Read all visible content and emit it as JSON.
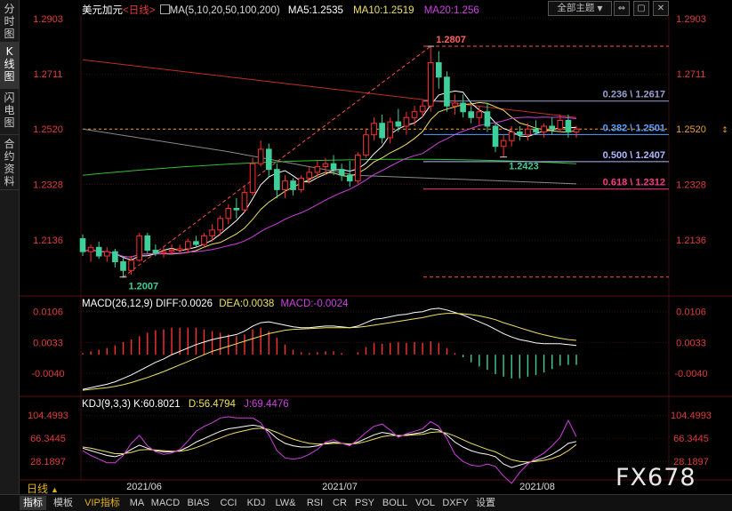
{
  "header": {
    "symbol": "美元加元",
    "period": "<日线>",
    "ma_label": "MA(5,10,20,50,100,200)",
    "ma5": "MA5:1.2535",
    "ma10": "MA10:1.2519",
    "ma20": "MA20:1.256",
    "theme_button": "全部主题",
    "theme_arrow": "▼"
  },
  "window_buttons": [
    "⇔",
    "▢",
    "✕"
  ],
  "left_nav": [
    {
      "label": "分时图",
      "active": false
    },
    {
      "label": "K线图",
      "active": true
    },
    {
      "label": "闪电图",
      "active": false
    },
    {
      "label": "合约资料",
      "active": false
    }
  ],
  "colors": {
    "up": "#3fcf9a",
    "down": "#ff3030",
    "ma5": "#ffffff",
    "ma10": "#f0e060",
    "ma20": "#d040e0",
    "ma50": "#30c030",
    "ma100": "#8a8a8a",
    "ma200": "#c03020",
    "axis_text": "#e03c3c",
    "grid": "#3a0f0f"
  },
  "chart_data": [
    {
      "type": "candlestick",
      "title": "美元加元 日线",
      "y_ticks": [
        "1.2903",
        "1.2711",
        "1.2520",
        "1.2328",
        "1.2136"
      ],
      "ylim": [
        1.196,
        1.2915
      ],
      "current_price": "1.2520",
      "x_labels": [
        "2021/06",
        "2021/07",
        "2021/08"
      ],
      "ohlc": [
        [
          1.214,
          1.2155,
          1.208,
          1.2095
        ],
        [
          1.2095,
          1.212,
          1.206,
          1.211
        ],
        [
          1.211,
          1.213,
          1.207,
          1.208
        ],
        [
          1.208,
          1.211,
          1.206,
          1.2095
        ],
        [
          1.2095,
          1.2105,
          1.204,
          1.206
        ],
        [
          1.206,
          1.208,
          1.2005,
          1.203
        ],
        [
          1.203,
          1.208,
          1.2015,
          1.2065
        ],
        [
          1.2065,
          1.216,
          1.206,
          1.215
        ],
        [
          1.215,
          1.216,
          1.209,
          1.21
        ],
        [
          1.21,
          1.212,
          1.208,
          1.209
        ],
        [
          1.209,
          1.211,
          1.2075,
          1.2095
        ],
        [
          1.2095,
          1.212,
          1.2085,
          1.21
        ],
        [
          1.21,
          1.212,
          1.209,
          1.2105
        ],
        [
          1.2105,
          1.214,
          1.209,
          1.213
        ],
        [
          1.213,
          1.215,
          1.211,
          1.212
        ],
        [
          1.212,
          1.216,
          1.211,
          1.215
        ],
        [
          1.215,
          1.219,
          1.213,
          1.217
        ],
        [
          1.217,
          1.222,
          1.215,
          1.221
        ],
        [
          1.221,
          1.226,
          1.219,
          1.2245
        ],
        [
          1.2245,
          1.228,
          1.221,
          1.224
        ],
        [
          1.224,
          1.232,
          1.223,
          1.23
        ],
        [
          1.23,
          1.242,
          1.229,
          1.24
        ],
        [
          1.24,
          1.248,
          1.239,
          1.245
        ],
        [
          1.245,
          1.247,
          1.235,
          1.238
        ],
        [
          1.238,
          1.24,
          1.228,
          1.231
        ],
        [
          1.231,
          1.236,
          1.228,
          1.234
        ],
        [
          1.234,
          1.235,
          1.229,
          1.231
        ],
        [
          1.231,
          1.236,
          1.23,
          1.235
        ],
        [
          1.235,
          1.239,
          1.233,
          1.237
        ],
        [
          1.237,
          1.241,
          1.235,
          1.239
        ],
        [
          1.239,
          1.242,
          1.236,
          1.24
        ],
        [
          1.24,
          1.243,
          1.236,
          1.238
        ],
        [
          1.238,
          1.24,
          1.234,
          1.236
        ],
        [
          1.236,
          1.241,
          1.232,
          1.234
        ],
        [
          1.234,
          1.244,
          1.233,
          1.243
        ],
        [
          1.243,
          1.252,
          1.242,
          1.25
        ],
        [
          1.25,
          1.256,
          1.248,
          1.254
        ],
        [
          1.254,
          1.257,
          1.247,
          1.249
        ],
        [
          1.249,
          1.256,
          1.247,
          1.2545
        ],
        [
          1.2545,
          1.259,
          1.251,
          1.253
        ],
        [
          1.253,
          1.258,
          1.25,
          1.256
        ],
        [
          1.256,
          1.26,
          1.253,
          1.258
        ],
        [
          1.258,
          1.262,
          1.256,
          1.26
        ],
        [
          1.26,
          1.2807,
          1.258,
          1.275
        ],
        [
          1.275,
          1.279,
          1.266,
          1.27
        ],
        [
          1.27,
          1.272,
          1.258,
          1.26
        ],
        [
          1.26,
          1.264,
          1.257,
          1.261
        ],
        [
          1.261,
          1.264,
          1.256,
          1.258
        ],
        [
          1.258,
          1.26,
          1.254,
          1.256
        ],
        [
          1.256,
          1.26,
          1.253,
          1.258
        ],
        [
          1.258,
          1.261,
          1.251,
          1.253
        ],
        [
          1.253,
          1.254,
          1.244,
          1.246
        ],
        [
          1.246,
          1.25,
          1.2423,
          1.248
        ],
        [
          1.248,
          1.253,
          1.246,
          1.251
        ],
        [
          1.251,
          1.253,
          1.248,
          1.25
        ],
        [
          1.25,
          1.254,
          1.248,
          1.252
        ],
        [
          1.252,
          1.255,
          1.25,
          1.251
        ],
        [
          1.251,
          1.254,
          1.249,
          1.253
        ],
        [
          1.253,
          1.256,
          1.25,
          1.252
        ],
        [
          1.252,
          1.257,
          1.251,
          1.255
        ],
        [
          1.255,
          1.257,
          1.249,
          1.251
        ],
        [
          1.251,
          1.253,
          1.249,
          1.252
        ]
      ],
      "annotations": [
        {
          "text": "1.2807",
          "value": 1.2807,
          "index": 43
        },
        {
          "text": "1.2007",
          "value": 1.2007,
          "index": 5
        },
        {
          "text": "1.2423",
          "value": 1.2423,
          "index": 52
        }
      ],
      "fib_levels": [
        {
          "label": "0.236 \\ 1.2617",
          "value": 1.2617,
          "color": "#9aa0d0"
        },
        {
          "label": "0.382 \\ 1.2501",
          "value": 1.2501,
          "color": "#5aa0ff"
        },
        {
          "label": "0.500 \\ 1.2407",
          "value": 1.2407,
          "color": "#b0b8ff"
        },
        {
          "label": "0.618 \\ 1.2312",
          "value": 1.2312,
          "color": "#ff3a8a"
        }
      ],
      "fib_range_lines": [
        1.2807,
        1.2007
      ],
      "ma_series": {
        "ma200": [
          1.276,
          1.256
        ],
        "ma100": [
          1.252,
          1.233
        ],
        "ma50_start": 1.236,
        "ma50_mid": 1.223,
        "ma50_end": 1.24
      }
    },
    {
      "type": "line",
      "title": "MACD(26,12,9)",
      "diff": "DIFF:0.0026",
      "dea": "DEA:0.0038",
      "macd": "MACD:-0.0024",
      "y_ticks": [
        "0.0106",
        "0.0033",
        "-0.0040"
      ],
      "ylim": [
        -0.0082,
        0.0118
      ],
      "series": [
        {
          "name": "DIFF",
          "values": [
            -0.0078,
            -0.0074,
            -0.007,
            -0.0066,
            -0.006,
            -0.0052,
            -0.0044,
            -0.0034,
            -0.0024,
            -0.0014,
            -0.0006,
            0.0004,
            0.0012,
            0.002,
            0.0028,
            0.0034,
            0.004,
            0.0044,
            0.0048,
            0.0052,
            0.006,
            0.0072,
            0.008,
            0.0082,
            0.0078,
            0.0074,
            0.007,
            0.0068,
            0.0068,
            0.007,
            0.0072,
            0.0072,
            0.007,
            0.0068,
            0.0072,
            0.008,
            0.0088,
            0.009,
            0.0094,
            0.0098,
            0.01,
            0.0104,
            0.0106,
            0.0112,
            0.0114,
            0.011,
            0.0104,
            0.0098,
            0.009,
            0.0082,
            0.0074,
            0.0064,
            0.0054,
            0.0046,
            0.004,
            0.0036,
            0.0032,
            0.003,
            0.003,
            0.003,
            0.0028,
            0.0026
          ]
        },
        {
          "name": "DEA",
          "values": [
            -0.008,
            -0.0078,
            -0.0076,
            -0.0074,
            -0.0071,
            -0.0067,
            -0.0062,
            -0.0056,
            -0.005,
            -0.0043,
            -0.0036,
            -0.0028,
            -0.002,
            -0.0012,
            -0.0004,
            0.0004,
            0.0012,
            0.0018,
            0.0024,
            0.003,
            0.0036,
            0.0042,
            0.0048,
            0.0054,
            0.0058,
            0.0062,
            0.0064,
            0.0065,
            0.0066,
            0.0067,
            0.0068,
            0.0068,
            0.0068,
            0.0068,
            0.0069,
            0.0071,
            0.0074,
            0.0077,
            0.008,
            0.0083,
            0.0086,
            0.0089,
            0.0092,
            0.0096,
            0.01,
            0.0102,
            0.0102,
            0.0101,
            0.0099,
            0.0096,
            0.0092,
            0.0087,
            0.008,
            0.0074,
            0.0068,
            0.0062,
            0.0056,
            0.0051,
            0.0047,
            0.0043,
            0.004,
            0.0038
          ]
        }
      ]
    },
    {
      "type": "line",
      "title": "KDJ(9,3,3)",
      "k": "K:60.8021",
      "d": "D:56.4794",
      "j": "J:69.4476",
      "y_ticks": [
        "104.4993",
        "66.3445",
        "28.1897"
      ],
      "ylim": [
        5,
        118
      ],
      "series": [
        {
          "name": "K",
          "values": [
            50,
            46,
            42,
            38,
            36,
            40,
            48,
            55,
            50,
            46,
            44,
            44,
            46,
            52,
            60,
            66,
            72,
            78,
            82,
            84,
            86,
            88,
            86,
            78,
            66,
            58,
            54,
            52,
            52,
            54,
            58,
            60,
            58,
            56,
            60,
            66,
            72,
            76,
            74,
            70,
            72,
            74,
            76,
            82,
            80,
            72,
            60,
            52,
            46,
            42,
            40,
            36,
            24,
            18,
            22,
            26,
            30,
            34,
            40,
            48,
            58,
            61
          ]
        },
        {
          "name": "D",
          "values": [
            52,
            50,
            47,
            44,
            41,
            41,
            43,
            47,
            48,
            47,
            46,
            45,
            45,
            47,
            51,
            56,
            62,
            67,
            72,
            76,
            79,
            82,
            83,
            81,
            76,
            70,
            65,
            61,
            58,
            57,
            57,
            58,
            58,
            57,
            58,
            61,
            65,
            69,
            71,
            71,
            71,
            72,
            73,
            76,
            77,
            75,
            70,
            64,
            58,
            53,
            48,
            44,
            37,
            31,
            28,
            27,
            28,
            30,
            33,
            38,
            46,
            56
          ]
        },
        {
          "name": "J",
          "values": [
            46,
            38,
            32,
            26,
            26,
            38,
            58,
            71,
            54,
            44,
            40,
            42,
            48,
            62,
            78,
            86,
            92,
            100,
            102,
            100,
            100,
            100,
            92,
            72,
            46,
            34,
            32,
            34,
            40,
            48,
            60,
            64,
            58,
            54,
            64,
            76,
            86,
            90,
            80,
            68,
            74,
            78,
            82,
            94,
            86,
            66,
            40,
            28,
            22,
            20,
            24,
            20,
            4,
            -8,
            10,
            24,
            34,
            42,
            54,
            68,
            96,
            69
          ]
        }
      ]
    }
  ],
  "watermark": "FX678",
  "bottom_tabs": [
    {
      "label": "指标",
      "active": true
    },
    {
      "label": "模板",
      "active": false
    },
    {
      "label": "VIP指标",
      "active": false,
      "vip": true
    },
    {
      "label": "MA"
    },
    {
      "label": "MACD"
    },
    {
      "label": "BIAS"
    },
    {
      "label": "CCI"
    },
    {
      "label": "KDJ"
    },
    {
      "label": "LW&"
    },
    {
      "label": "RSI"
    },
    {
      "label": "CR"
    },
    {
      "label": "PSY"
    },
    {
      "label": "BOLL"
    },
    {
      "label": "VOL"
    },
    {
      "label": "DXFY"
    },
    {
      "label": "设置"
    }
  ],
  "period_selector": "日线",
  "period_selector_arrow": "▲"
}
